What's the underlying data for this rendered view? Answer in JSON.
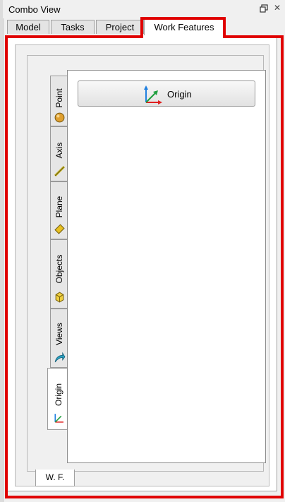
{
  "window": {
    "title": "Combo View",
    "float_icon": "float-window-icon",
    "close_glyph": "✕"
  },
  "tabs": [
    {
      "label": "Model",
      "active": false
    },
    {
      "label": "Tasks",
      "active": false
    },
    {
      "label": "Project",
      "active": false
    },
    {
      "label": "Work Features",
      "active": true
    }
  ],
  "vertical_tabs": [
    {
      "label": "Point",
      "icon": "point-sphere-icon"
    },
    {
      "label": "Axis",
      "icon": "axis-line-icon"
    },
    {
      "label": "Plane",
      "icon": "plane-icon"
    },
    {
      "label": "Objects",
      "icon": "cube-icon"
    },
    {
      "label": "Views",
      "icon": "views-arrow-icon"
    },
    {
      "label": "Origin",
      "icon": "origin-axes-icon",
      "active": true
    }
  ],
  "content": {
    "origin_button_label": "Origin",
    "origin_button_icon": "origin-axes-icon"
  },
  "bottom_tab": {
    "label": "W. F."
  },
  "colors": {
    "highlight": "#e00000",
    "point": "#e0a030",
    "axis": "#c8b428",
    "plane": "#e8c020",
    "objects": "#f0d040",
    "views": "#2aa0c0",
    "axis_x": "#e02020",
    "axis_y": "#20a040",
    "axis_z": "#2080e0"
  }
}
